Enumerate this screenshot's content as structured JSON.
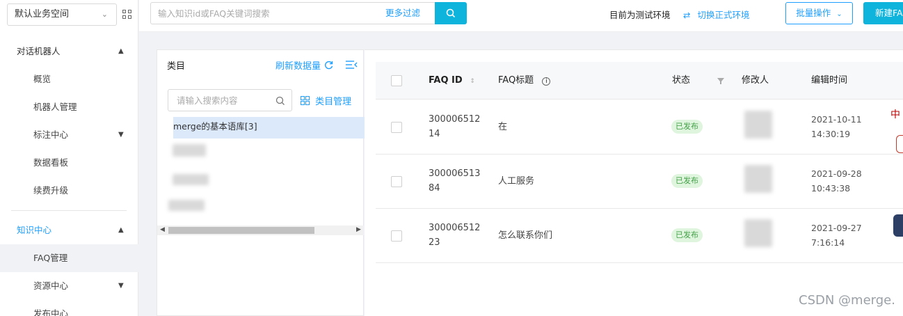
{
  "sidebar": {
    "workspace": "默认业务空间",
    "items": [
      {
        "label": "对话机器人",
        "arrow": "^"
      },
      {
        "label": "概览"
      },
      {
        "label": "机器人管理"
      },
      {
        "label": "标注中心",
        "arrow": "v"
      },
      {
        "label": "数据看板"
      },
      {
        "label": "续费升级"
      },
      {
        "label": "知识中心",
        "arrow": "^"
      },
      {
        "label": "FAQ管理"
      },
      {
        "label": "资源中心",
        "arrow": "v"
      },
      {
        "label": "发布中心"
      }
    ]
  },
  "topbar": {
    "search_placeholder": "输入知识id或FAQ关键词搜索",
    "more_filter": "更多过滤",
    "env_label": "目前为测试环境",
    "env_switch": "切换正式环境",
    "batch": "批量操作",
    "new_button": "新建FAQ"
  },
  "category": {
    "title": "类目",
    "refresh": "刷新数据量",
    "search_placeholder": "请输入搜索内容",
    "manage": "类目管理",
    "selected": "merge的基本语库[3]"
  },
  "table": {
    "headers": {
      "id": "FAQ ID",
      "title": "FAQ标题",
      "status": "状态",
      "modifier": "修改人",
      "time": "编辑时间"
    },
    "rows": [
      {
        "id1": "300006512",
        "id2": "14",
        "title": "在",
        "status": "已发布",
        "date": "2021-10-11",
        "time": "14:30:19"
      },
      {
        "id1": "300006513",
        "id2": "84",
        "title": "人工服务",
        "status": "已发布",
        "date": "2021-09-28",
        "time": "10:43:38"
      },
      {
        "id1": "300006512",
        "id2": "23",
        "title": "怎么联系你们",
        "status": "已发布",
        "date": "2021-09-27",
        "time": "7:16:14"
      }
    ]
  },
  "watermark": "CSDN @merge.",
  "colors": {
    "primary": "#1e9fff",
    "accent": "#0fb4dc",
    "published_bg": "#dff5de",
    "published_text": "#43a047"
  }
}
